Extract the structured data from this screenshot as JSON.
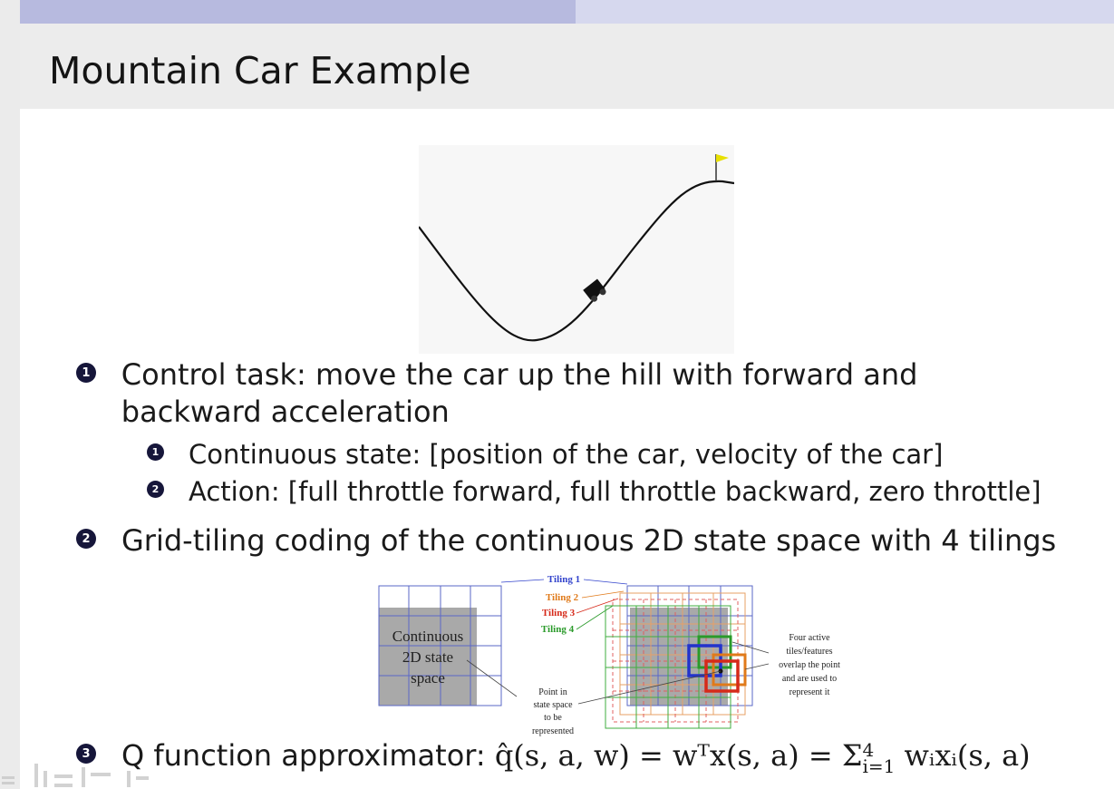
{
  "slide": {
    "title": "Mountain Car Example",
    "header_colors": {
      "left": "#b7badf",
      "right": "#d6d8ee"
    }
  },
  "bullets": {
    "b1": {
      "number": "1",
      "text": "Control task: move the car up the hill with forward and backward acceleration",
      "sub": [
        {
          "number": "1",
          "text": "Continuous state: [position of the car, velocity of the car]"
        },
        {
          "number": "2",
          "text": "Action: [full throttle forward, full throttle backward, zero throttle]"
        }
      ]
    },
    "b2": {
      "number": "2",
      "text": "Grid-tiling coding of the continuous 2D state space with 4 tilings"
    },
    "b3": {
      "number": "3",
      "label": "Q function approximator:",
      "eq_lhs": "q̂(s, a, w)",
      "eq_mid": "wᵀx(s, a)",
      "eq_rhs": "Σ",
      "eq_sum_top": "4",
      "eq_sum_bottom": "i=1",
      "eq_sum_body": "wᵢxᵢ(s, a)"
    }
  },
  "tiling_figure": {
    "continuous_label": [
      "Continuous",
      "2D state",
      "space"
    ],
    "tiling_labels": [
      "Tiling 1",
      "Tiling 2",
      "Tiling 3",
      "Tiling 4"
    ],
    "tiling_colors": [
      "#3344cc",
      "#e07a1a",
      "#d62a1a",
      "#2a9a2a"
    ],
    "point_label": [
      "Point in",
      "state space",
      "to be",
      "represented"
    ],
    "active_label": [
      "Four active",
      "tiles/features",
      "overlap the point",
      "and are used to",
      "represent it"
    ]
  }
}
